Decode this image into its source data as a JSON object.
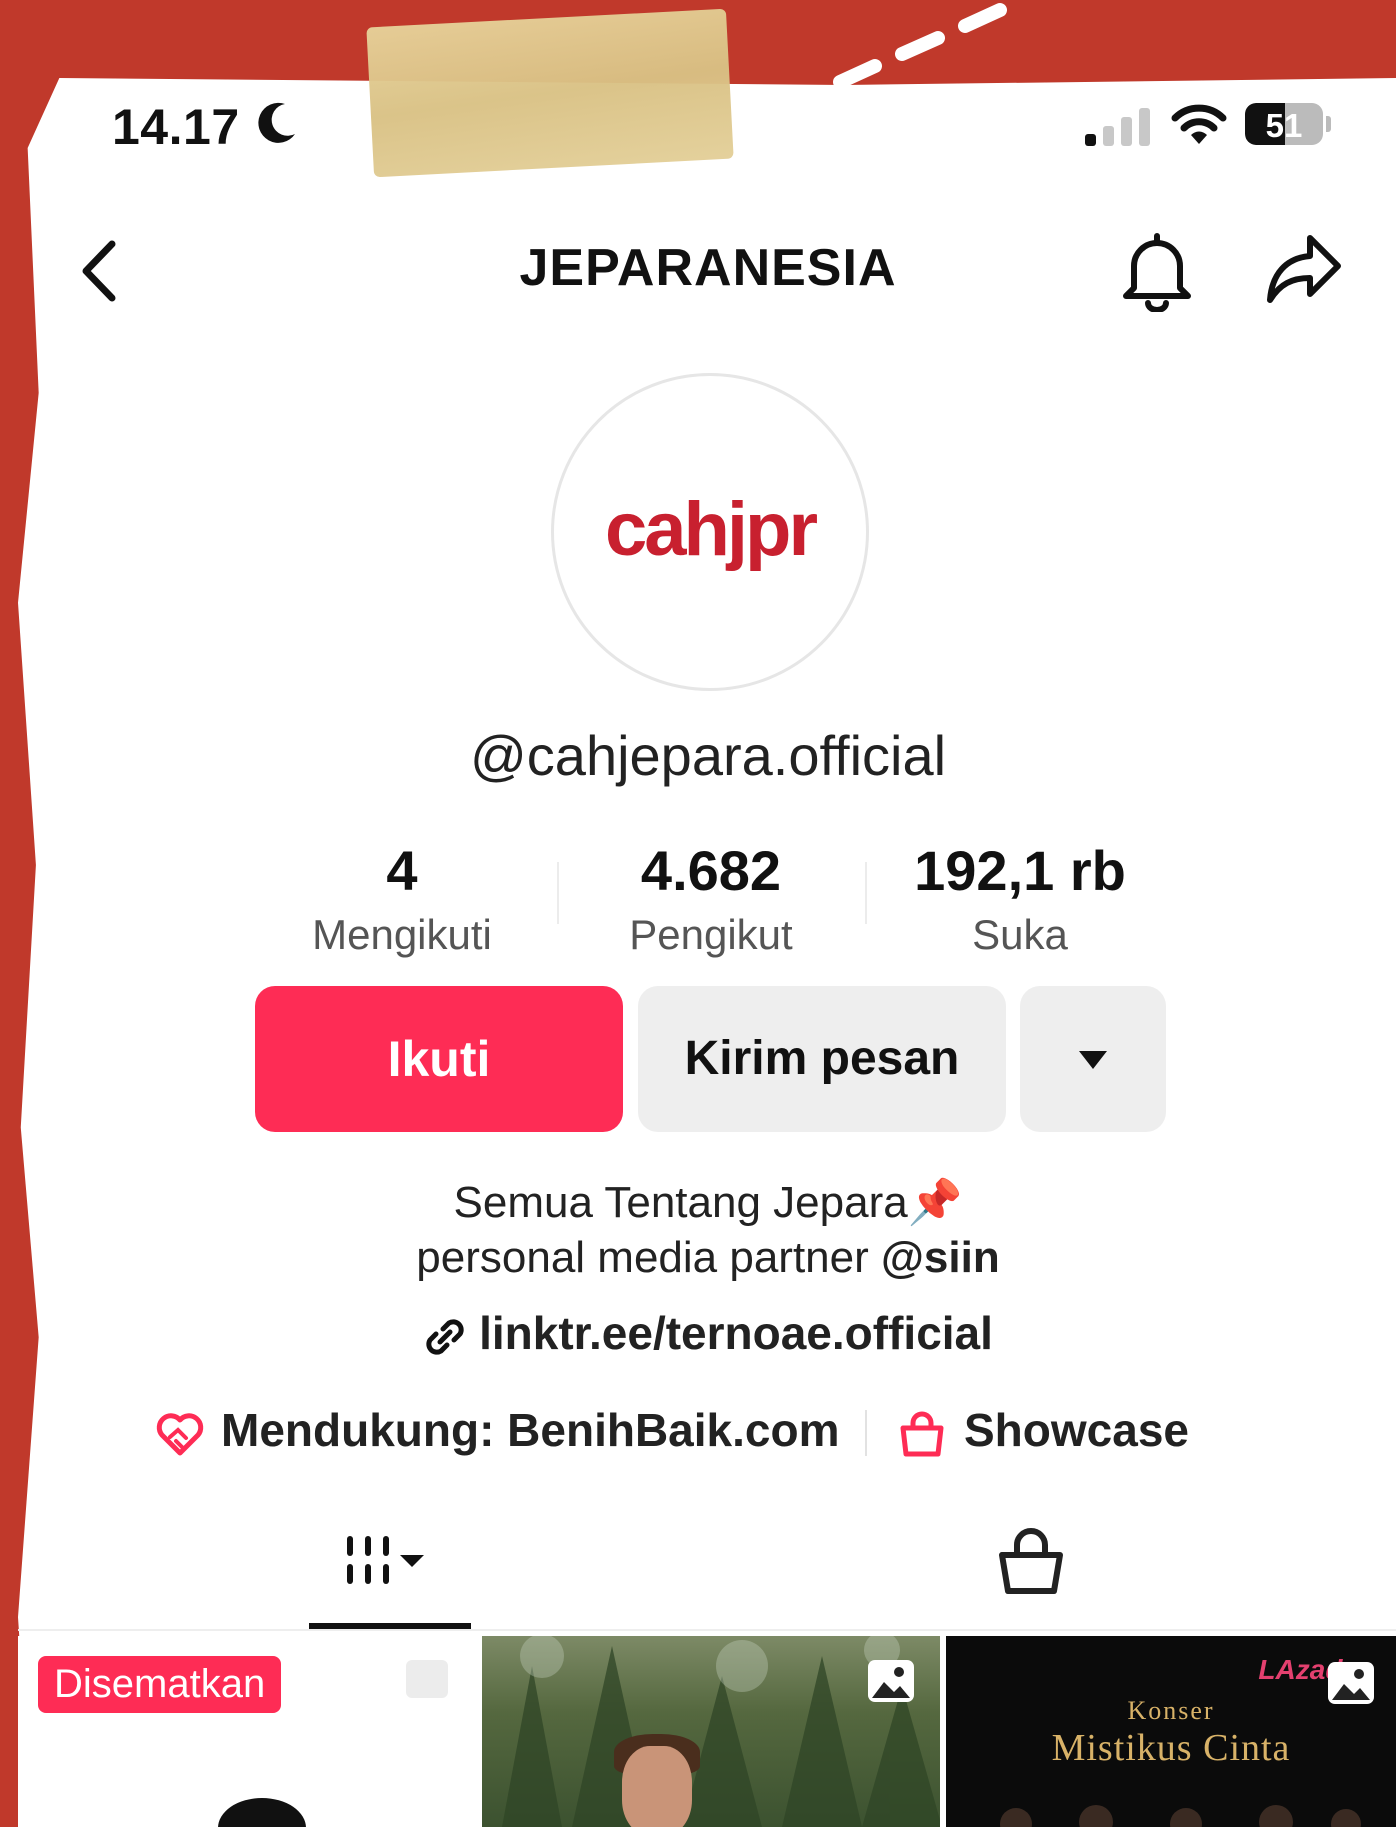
{
  "status_bar": {
    "time": "14.17",
    "battery": "51",
    "battery_level": 0.51
  },
  "header": {
    "title": "JEPARANESIA"
  },
  "profile": {
    "avatar_logo": "cahjpr",
    "username": "@cahjepara.official",
    "stats": [
      {
        "value": "4",
        "label": "Mengikuti"
      },
      {
        "value": "4.682",
        "label": "Pengikut"
      },
      {
        "value": "192,1 rb",
        "label": "Suka"
      }
    ],
    "follow_label": "Ikuti",
    "message_label": "Kirim pesan",
    "bio_line1": "Semua Tentang Jepara📌",
    "bio_line2_prefix": "personal media partner ",
    "bio_line2_mention": "@siin",
    "link": "linktr.ee/ternoae.official",
    "support_label": "Mendukung: BenihBaik.com",
    "showcase_label": "Showcase"
  },
  "grid": {
    "pinned_label": "Disematkan",
    "thumb3_brand": "LAzada",
    "thumb3_sub": "Konser",
    "thumb3_title": "Mistikus Cinta"
  },
  "colors": {
    "accent": "#fe2c55",
    "background": "#c0392b",
    "avatar_logo": "#c8202f"
  }
}
